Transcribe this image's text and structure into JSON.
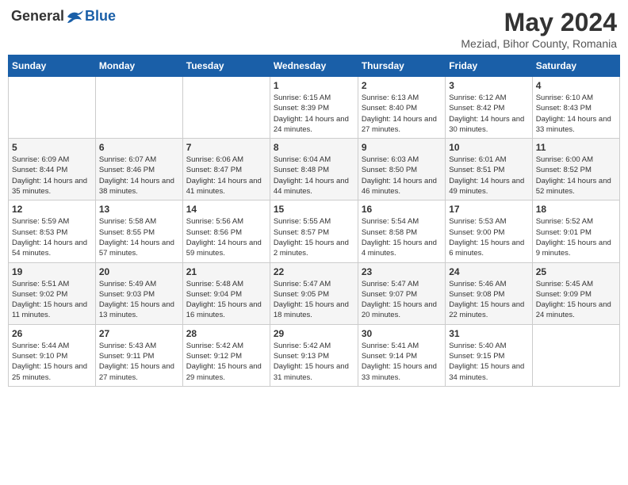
{
  "header": {
    "logo_general": "General",
    "logo_blue": "Blue",
    "month_title": "May 2024",
    "location": "Meziad, Bihor County, Romania"
  },
  "weekdays": [
    "Sunday",
    "Monday",
    "Tuesday",
    "Wednesday",
    "Thursday",
    "Friday",
    "Saturday"
  ],
  "weeks": [
    [
      {
        "day": "",
        "info": ""
      },
      {
        "day": "",
        "info": ""
      },
      {
        "day": "",
        "info": ""
      },
      {
        "day": "1",
        "info": "Sunrise: 6:15 AM\nSunset: 8:39 PM\nDaylight: 14 hours and 24 minutes."
      },
      {
        "day": "2",
        "info": "Sunrise: 6:13 AM\nSunset: 8:40 PM\nDaylight: 14 hours and 27 minutes."
      },
      {
        "day": "3",
        "info": "Sunrise: 6:12 AM\nSunset: 8:42 PM\nDaylight: 14 hours and 30 minutes."
      },
      {
        "day": "4",
        "info": "Sunrise: 6:10 AM\nSunset: 8:43 PM\nDaylight: 14 hours and 33 minutes."
      }
    ],
    [
      {
        "day": "5",
        "info": "Sunrise: 6:09 AM\nSunset: 8:44 PM\nDaylight: 14 hours and 35 minutes."
      },
      {
        "day": "6",
        "info": "Sunrise: 6:07 AM\nSunset: 8:46 PM\nDaylight: 14 hours and 38 minutes."
      },
      {
        "day": "7",
        "info": "Sunrise: 6:06 AM\nSunset: 8:47 PM\nDaylight: 14 hours and 41 minutes."
      },
      {
        "day": "8",
        "info": "Sunrise: 6:04 AM\nSunset: 8:48 PM\nDaylight: 14 hours and 44 minutes."
      },
      {
        "day": "9",
        "info": "Sunrise: 6:03 AM\nSunset: 8:50 PM\nDaylight: 14 hours and 46 minutes."
      },
      {
        "day": "10",
        "info": "Sunrise: 6:01 AM\nSunset: 8:51 PM\nDaylight: 14 hours and 49 minutes."
      },
      {
        "day": "11",
        "info": "Sunrise: 6:00 AM\nSunset: 8:52 PM\nDaylight: 14 hours and 52 minutes."
      }
    ],
    [
      {
        "day": "12",
        "info": "Sunrise: 5:59 AM\nSunset: 8:53 PM\nDaylight: 14 hours and 54 minutes."
      },
      {
        "day": "13",
        "info": "Sunrise: 5:58 AM\nSunset: 8:55 PM\nDaylight: 14 hours and 57 minutes."
      },
      {
        "day": "14",
        "info": "Sunrise: 5:56 AM\nSunset: 8:56 PM\nDaylight: 14 hours and 59 minutes."
      },
      {
        "day": "15",
        "info": "Sunrise: 5:55 AM\nSunset: 8:57 PM\nDaylight: 15 hours and 2 minutes."
      },
      {
        "day": "16",
        "info": "Sunrise: 5:54 AM\nSunset: 8:58 PM\nDaylight: 15 hours and 4 minutes."
      },
      {
        "day": "17",
        "info": "Sunrise: 5:53 AM\nSunset: 9:00 PM\nDaylight: 15 hours and 6 minutes."
      },
      {
        "day": "18",
        "info": "Sunrise: 5:52 AM\nSunset: 9:01 PM\nDaylight: 15 hours and 9 minutes."
      }
    ],
    [
      {
        "day": "19",
        "info": "Sunrise: 5:51 AM\nSunset: 9:02 PM\nDaylight: 15 hours and 11 minutes."
      },
      {
        "day": "20",
        "info": "Sunrise: 5:49 AM\nSunset: 9:03 PM\nDaylight: 15 hours and 13 minutes."
      },
      {
        "day": "21",
        "info": "Sunrise: 5:48 AM\nSunset: 9:04 PM\nDaylight: 15 hours and 16 minutes."
      },
      {
        "day": "22",
        "info": "Sunrise: 5:47 AM\nSunset: 9:05 PM\nDaylight: 15 hours and 18 minutes."
      },
      {
        "day": "23",
        "info": "Sunrise: 5:47 AM\nSunset: 9:07 PM\nDaylight: 15 hours and 20 minutes."
      },
      {
        "day": "24",
        "info": "Sunrise: 5:46 AM\nSunset: 9:08 PM\nDaylight: 15 hours and 22 minutes."
      },
      {
        "day": "25",
        "info": "Sunrise: 5:45 AM\nSunset: 9:09 PM\nDaylight: 15 hours and 24 minutes."
      }
    ],
    [
      {
        "day": "26",
        "info": "Sunrise: 5:44 AM\nSunset: 9:10 PM\nDaylight: 15 hours and 25 minutes."
      },
      {
        "day": "27",
        "info": "Sunrise: 5:43 AM\nSunset: 9:11 PM\nDaylight: 15 hours and 27 minutes."
      },
      {
        "day": "28",
        "info": "Sunrise: 5:42 AM\nSunset: 9:12 PM\nDaylight: 15 hours and 29 minutes."
      },
      {
        "day": "29",
        "info": "Sunrise: 5:42 AM\nSunset: 9:13 PM\nDaylight: 15 hours and 31 minutes."
      },
      {
        "day": "30",
        "info": "Sunrise: 5:41 AM\nSunset: 9:14 PM\nDaylight: 15 hours and 33 minutes."
      },
      {
        "day": "31",
        "info": "Sunrise: 5:40 AM\nSunset: 9:15 PM\nDaylight: 15 hours and 34 minutes."
      },
      {
        "day": "",
        "info": ""
      }
    ]
  ]
}
